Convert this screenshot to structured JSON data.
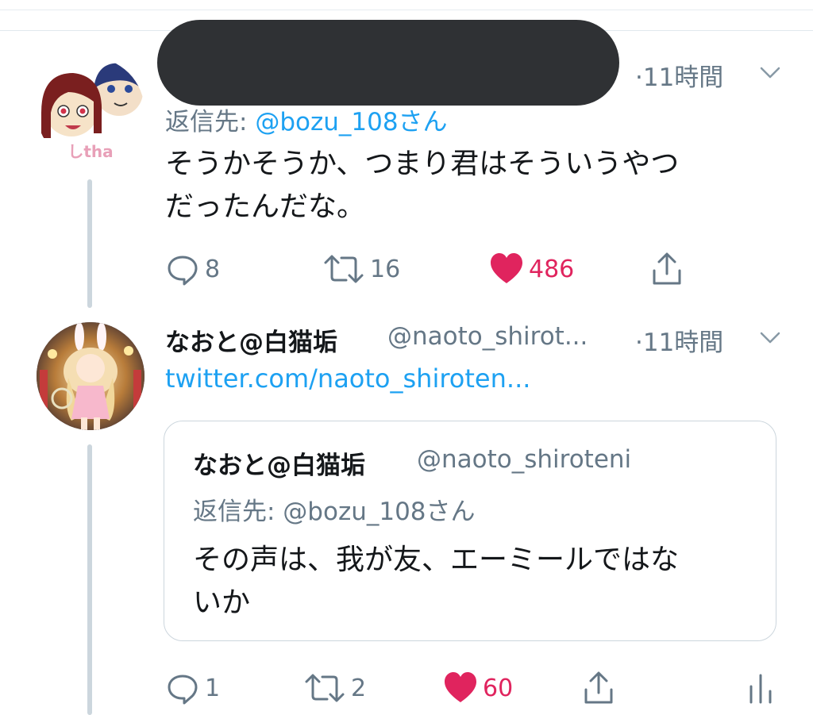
{
  "tweets": [
    {
      "timestamp": "·11時間",
      "reply_label": "返信先:",
      "reply_mention": "@bozu_108さん",
      "text_line1": "そうかそうか、つまり君はそういうやつ",
      "text_line2": "だったんだな。",
      "avatar_text": "しtha",
      "actions": {
        "replies": "8",
        "retweets": "16",
        "likes": "486"
      }
    },
    {
      "display_name": "なおと@白猫垢",
      "handle": "@naoto_shirot...",
      "timestamp": "·11時間",
      "link_text": "twitter.com/naoto_shiroten...",
      "quote": {
        "display_name": "なおと@白猫垢",
        "handle": "@naoto_shiroteni",
        "reply_text": "返信先: @bozu_108さん",
        "text_line1": "その声は、我が友、エーミールではな",
        "text_line2": "いか"
      },
      "actions": {
        "replies": "1",
        "retweets": "2",
        "likes": "60"
      }
    }
  ],
  "colors": {
    "accent_blue": "#1da1f2",
    "like_red": "#e0245e",
    "muted_gray": "#657786",
    "thread_line": "#ccd6dd",
    "redaction": "#2f3134"
  },
  "icons": [
    "reply-icon",
    "retweet-icon",
    "like-icon",
    "share-icon",
    "chevron-down-icon",
    "analytics-icon"
  ]
}
